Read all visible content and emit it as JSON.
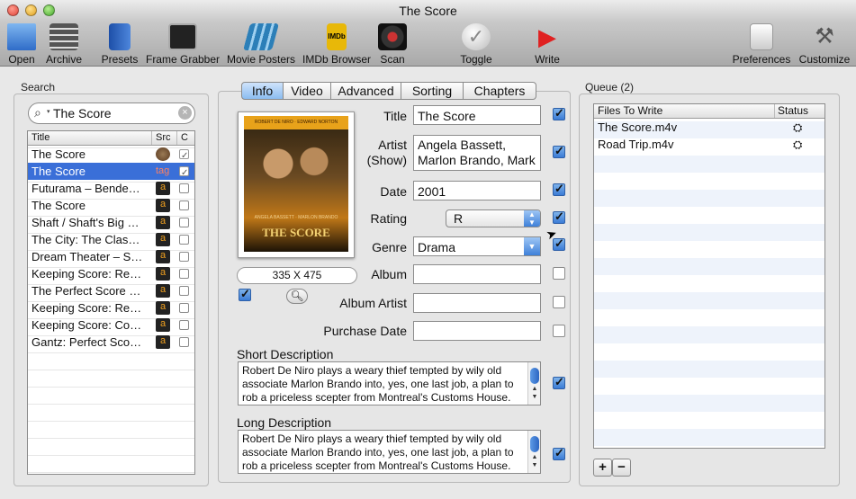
{
  "window": {
    "title": "The Score"
  },
  "toolbar": {
    "open": "Open",
    "archive": "Archive",
    "presets": "Presets",
    "frame_grabber": "Frame Grabber",
    "movie_posters": "Movie Posters",
    "imdb_browser": "IMDb Browser",
    "imdb_icon_text": "IMDb",
    "scan": "Scan",
    "toggle": "Toggle",
    "write": "Write",
    "preferences": "Preferences",
    "customize": "Customize"
  },
  "search": {
    "label": "Search",
    "query": "The Score",
    "columns": {
      "title": "Title",
      "src": "Src",
      "c": "C"
    },
    "results": [
      {
        "title": "The Score",
        "src": "imdb",
        "checked": true,
        "selected": false
      },
      {
        "title": "The Score",
        "src": "tag",
        "src_text": "tag",
        "checked": true,
        "selected": true
      },
      {
        "title": "Futurama – Bende…",
        "src": "amazon",
        "checked": false,
        "selected": false
      },
      {
        "title": "The Score",
        "src": "amazon",
        "checked": false,
        "selected": false
      },
      {
        "title": "Shaft / Shaft's Big …",
        "src": "amazon",
        "checked": false,
        "selected": false
      },
      {
        "title": "The City: The Clas…",
        "src": "amazon",
        "checked": false,
        "selected": false
      },
      {
        "title": "Dream Theater – S…",
        "src": "amazon",
        "checked": false,
        "selected": false
      },
      {
        "title": "Keeping Score: Re…",
        "src": "amazon",
        "checked": false,
        "selected": false
      },
      {
        "title": "The Perfect Score …",
        "src": "amazon",
        "checked": false,
        "selected": false
      },
      {
        "title": "Keeping Score: Re…",
        "src": "amazon",
        "checked": false,
        "selected": false
      },
      {
        "title": "Keeping Score: Co…",
        "src": "amazon",
        "checked": false,
        "selected": false
      },
      {
        "title": "Gantz: Perfect Sco…",
        "src": "amazon",
        "checked": false,
        "selected": false
      }
    ]
  },
  "tabs": [
    "Info",
    "Video",
    "Advanced",
    "Sorting",
    "Chapters"
  ],
  "active_tab": "Info",
  "poster": {
    "title_art": "THE SCORE",
    "top_names": "ROBERT DE NIRO · EDWARD NORTON",
    "bottom_names": "ANGELA BASSETT · MARLON BRANDO",
    "size": "335 X 475",
    "checked": true
  },
  "info": {
    "title_label": "Title",
    "title_value": "The Score",
    "artist_label": "Artist\n(Show)",
    "artist_value": "Angela Bassett, Marlon Brando, Mark",
    "date_label": "Date",
    "date_value": "2001",
    "rating_label": "Rating",
    "rating_value": "R",
    "genre_label": "Genre",
    "genre_value": "Drama",
    "album_label": "Album",
    "album_value": "",
    "album_artist_label": "Album Artist",
    "album_artist_value": "",
    "purchase_date_label": "Purchase Date",
    "purchase_date_value": "",
    "short_desc_label": "Short Description",
    "short_desc": "Robert De Niro plays a weary thief tempted by wily old associate Marlon Brando into, yes, one last job, a plan to rob a priceless scepter from Montreal's Customs House. Director Frank Oz's heist thriller partners De Niro with",
    "long_desc_label": "Long Description",
    "long_desc": "Robert De Niro plays a weary thief tempted by wily old associate Marlon Brando into, yes, one last job, a plan to rob a priceless scepter from Montreal's Customs House. Director Frank Oz's heist thriller partners De Niro with"
  },
  "queue": {
    "label": "Queue (2)",
    "col_files": "Files To Write",
    "col_status": "Status",
    "files": [
      "The Score.m4v",
      "Road Trip.m4v"
    ],
    "add": "+",
    "remove": "−"
  },
  "colors": {
    "selection": "#3a6fd8",
    "queue_stripe": "#eef3fb"
  }
}
